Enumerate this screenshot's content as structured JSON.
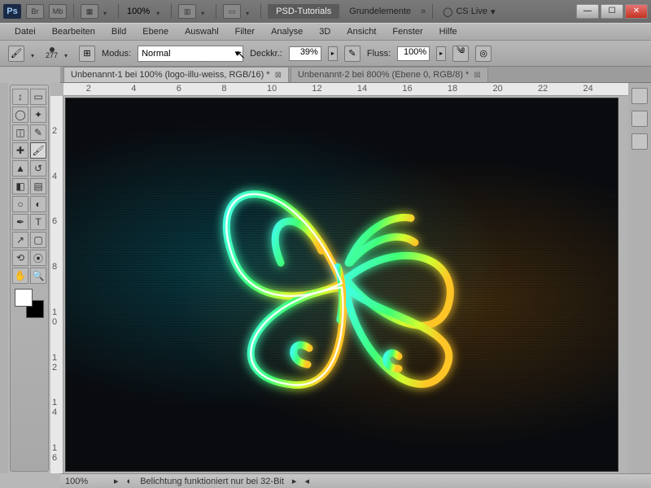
{
  "titlebar": {
    "app_abbrev": "Ps",
    "br_label": "Br",
    "mb_label": "Mb",
    "zoom": "100%",
    "workspace_label": "PSD-Tutorials",
    "workspace_secondary": "Grundelemente",
    "cslive": "CS Live"
  },
  "menu": {
    "items": [
      "Datei",
      "Bearbeiten",
      "Bild",
      "Ebene",
      "Auswahl",
      "Filter",
      "Analyse",
      "3D",
      "Ansicht",
      "Fenster",
      "Hilfe"
    ]
  },
  "options": {
    "brush_size": "277",
    "mode_label": "Modus:",
    "mode_value": "Normal",
    "opacity_label": "Deckkr.:",
    "opacity_value": "39%",
    "flow_label": "Fluss:",
    "flow_value": "100%"
  },
  "tabs": [
    {
      "label": "Unbenannt-1 bei 100% (logo-illu-weiss, RGB/16) *",
      "active": true
    },
    {
      "label": "Unbenannt-2 bei 800% (Ebene 0, RGB/8) *",
      "active": false
    }
  ],
  "ruler_h": [
    "2",
    "4",
    "6",
    "8",
    "10",
    "12",
    "14",
    "16",
    "18",
    "20",
    "22",
    "24"
  ],
  "ruler_v": [
    "2",
    "4",
    "6",
    "8",
    "1 0",
    "1 2",
    "1 4",
    "1 6"
  ],
  "status": {
    "zoom": "100%",
    "message": "Belichtung funktioniert nur bei 32-Bit"
  },
  "tools": [
    "move",
    "marquee",
    "lasso",
    "wand",
    "crop",
    "eyedropper",
    "heal",
    "brush",
    "stamp",
    "history",
    "eraser",
    "gradient",
    "blur",
    "dodge",
    "pen",
    "type",
    "path",
    "shape",
    "hand",
    "zoom",
    "3drotate",
    "3dcam"
  ]
}
